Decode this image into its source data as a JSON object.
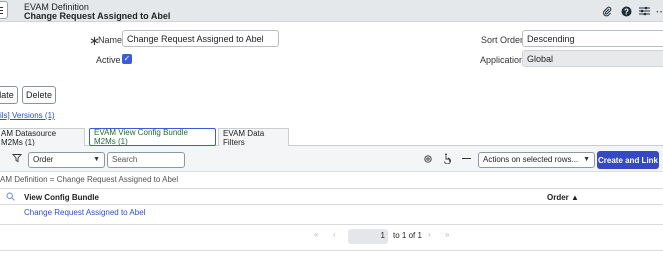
{
  "header": {
    "record_type": "EVAM Definition",
    "record_title": "Change Request Assigned to Abel"
  },
  "form": {
    "required_marker": "∗",
    "name_label": "Name",
    "name_value": "Change Request Assigned to Abel",
    "active_label": "Active",
    "active_checked": true,
    "sort_order_label": "Sort Order",
    "sort_order_value": "Descending",
    "application_label": "Application",
    "application_value": "Global"
  },
  "actions": {
    "update_label": "date",
    "delete_label": "Delete"
  },
  "related_links": "ils] Versions (1)",
  "tabs": [
    {
      "label": "AM Datasource M2Ms (1)"
    },
    {
      "label": "EVAM View Config Bundle M2Ms (1)"
    },
    {
      "label": "EVAM Data Filters"
    }
  ],
  "list": {
    "filter_field": "Order",
    "search_placeholder": "Search",
    "actions_select": "Actions on selected rows...",
    "create_link_label": "Create and Link",
    "breadcrumb": "AM Definition = Change Request Assigned to Abel",
    "columns": {
      "view_config_bundle": "View Config Bundle",
      "order": "Order ▲"
    },
    "rows": [
      {
        "view_config_bundle": "Change Request Assigned to Abel"
      }
    ]
  },
  "pagination": {
    "current_page": "1",
    "of_text": "to 1 of 1"
  },
  "colors": {
    "primary": "#3549c6",
    "link": "#2b4fcf",
    "active_tab_border": "#3b5bdb"
  }
}
